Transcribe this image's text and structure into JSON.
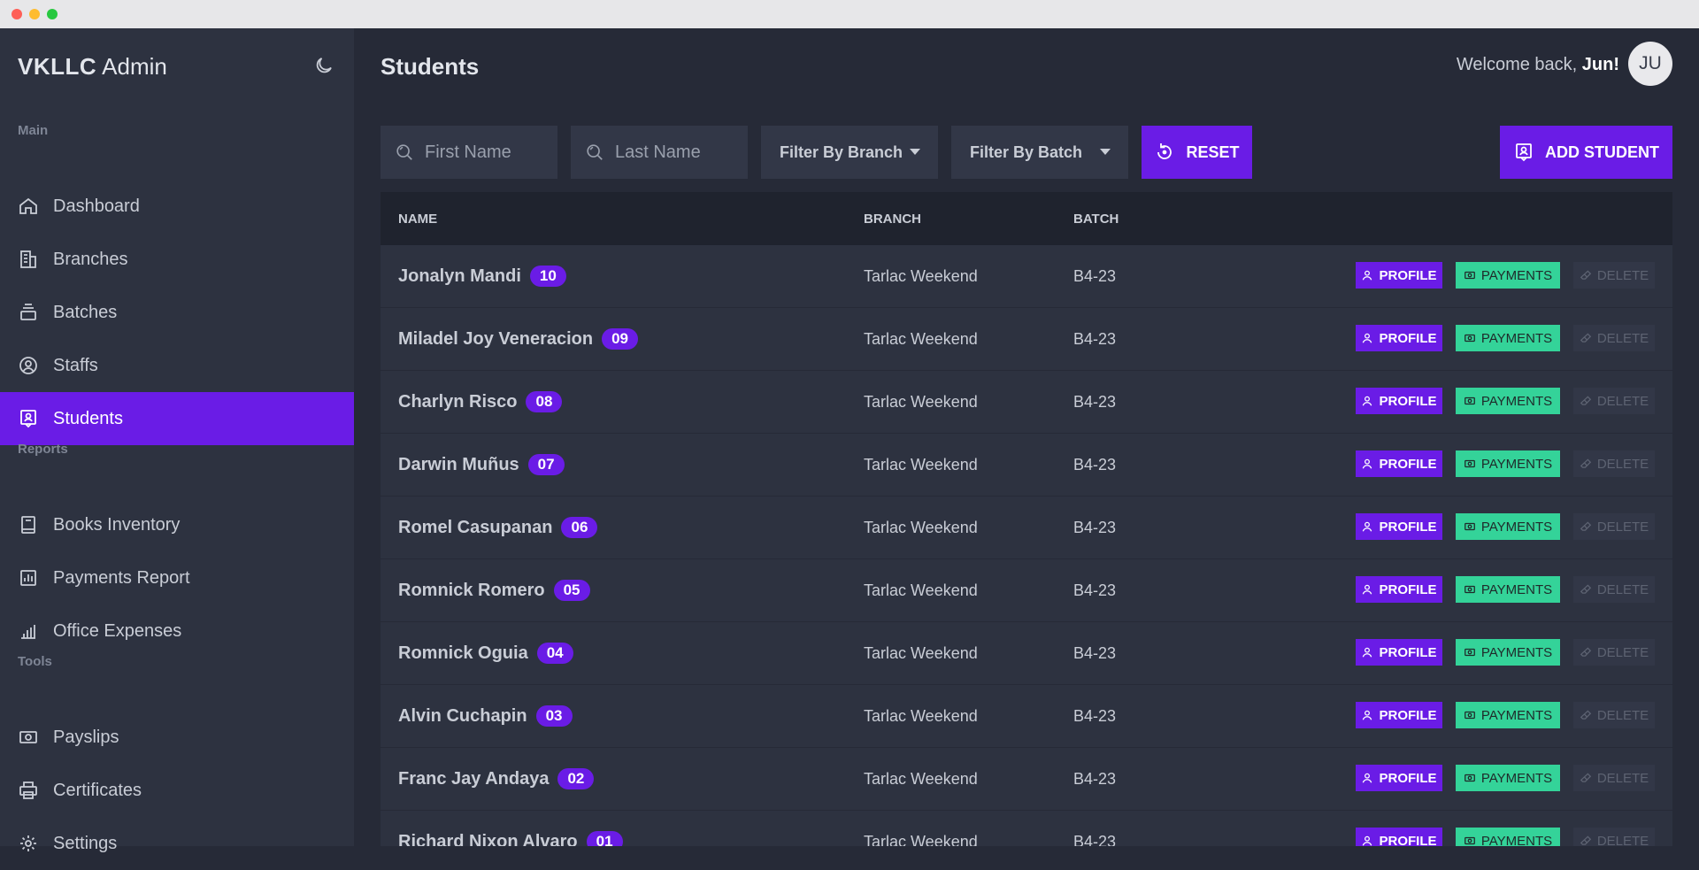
{
  "app": {
    "brand_bold": "VKLLC",
    "brand_rest": "Admin"
  },
  "sidebar": {
    "sections": [
      {
        "label": "Main",
        "items": [
          {
            "label": "Dashboard",
            "icon": "home-icon"
          },
          {
            "label": "Branches",
            "icon": "building-icon"
          },
          {
            "label": "Batches",
            "icon": "stack-icon"
          },
          {
            "label": "Staffs",
            "icon": "user-circle-icon"
          },
          {
            "label": "Students",
            "icon": "student-icon",
            "active": true
          }
        ]
      },
      {
        "label": "Reports",
        "items": [
          {
            "label": "Books Inventory",
            "icon": "book-icon"
          },
          {
            "label": "Payments Report",
            "icon": "report-icon"
          },
          {
            "label": "Office Expenses",
            "icon": "bar-chart-icon"
          }
        ]
      },
      {
        "label": "Tools",
        "items": [
          {
            "label": "Payslips",
            "icon": "cash-icon"
          },
          {
            "label": "Certificates",
            "icon": "printer-icon"
          },
          {
            "label": "Settings",
            "icon": "gear-icon"
          }
        ]
      }
    ]
  },
  "header": {
    "title": "Students",
    "welcome_prefix": "Welcome back,",
    "user_name": "Jun!",
    "avatar_initials": "JU"
  },
  "filters": {
    "first_name_placeholder": "First Name",
    "last_name_placeholder": "Last Name",
    "branch_label": "Filter By Branch",
    "batch_label": "Filter By Batch",
    "reset_label": "RESET",
    "add_label": "ADD STUDENT"
  },
  "table": {
    "columns": {
      "name": "NAME",
      "branch": "BRANCH",
      "batch": "BATCH"
    },
    "actions": {
      "profile": "PROFILE",
      "payments": "PAYMENTS",
      "delete": "DELETE"
    },
    "rows": [
      {
        "name": "Jonalyn Mandi",
        "badge": "10",
        "branch": "Tarlac Weekend",
        "batch": "B4-23"
      },
      {
        "name": "Miladel Joy Veneracion",
        "badge": "09",
        "branch": "Tarlac Weekend",
        "batch": "B4-23"
      },
      {
        "name": "Charlyn Risco",
        "badge": "08",
        "branch": "Tarlac Weekend",
        "batch": "B4-23"
      },
      {
        "name": "Darwin Muñus",
        "badge": "07",
        "branch": "Tarlac Weekend",
        "batch": "B4-23"
      },
      {
        "name": "Romel Casupanan",
        "badge": "06",
        "branch": "Tarlac Weekend",
        "batch": "B4-23"
      },
      {
        "name": "Romnick Romero",
        "badge": "05",
        "branch": "Tarlac Weekend",
        "batch": "B4-23"
      },
      {
        "name": "Romnick Oguia",
        "badge": "04",
        "branch": "Tarlac Weekend",
        "batch": "B4-23"
      },
      {
        "name": "Alvin Cuchapin",
        "badge": "03",
        "branch": "Tarlac Weekend",
        "batch": "B4-23"
      },
      {
        "name": "Franc Jay Andaya",
        "badge": "02",
        "branch": "Tarlac Weekend",
        "batch": "B4-23"
      },
      {
        "name": "Richard Nixon Alvaro",
        "badge": "01",
        "branch": "Tarlac Weekend",
        "batch": "B4-23"
      }
    ]
  },
  "colors": {
    "accent": "#6a1ce6",
    "success": "#34d399",
    "sidebar_bg": "#2d3240",
    "page_bg": "#262a37"
  }
}
